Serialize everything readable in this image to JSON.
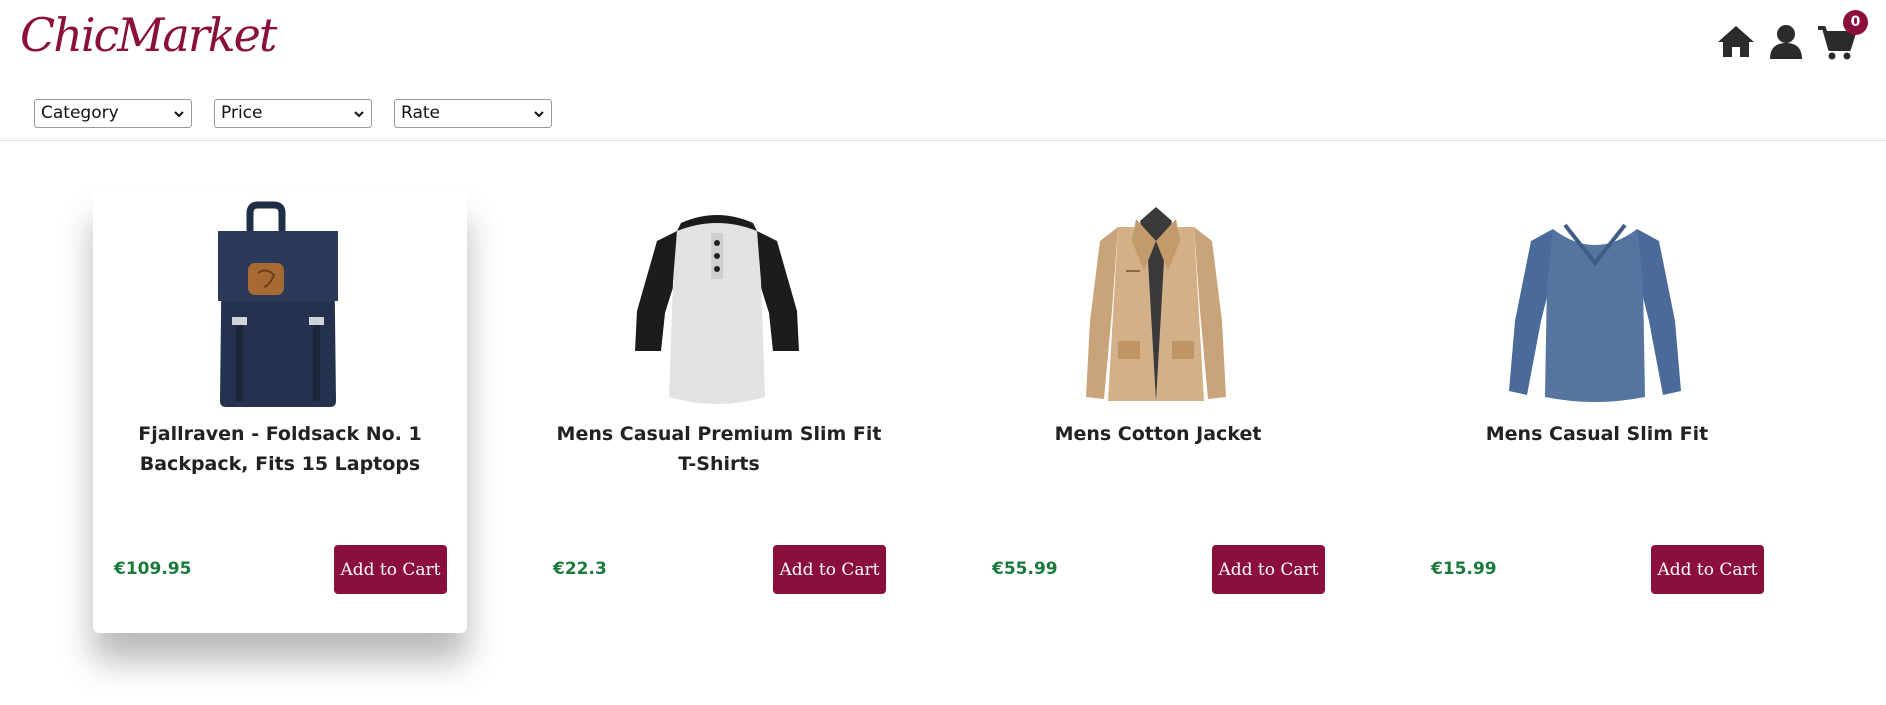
{
  "app": {
    "logo_text": "ChicMarket"
  },
  "nav": {
    "icons": [
      "home-icon",
      "user-icon",
      "cart-icon"
    ],
    "cart_count": "0"
  },
  "filters": [
    {
      "selected": "Category"
    },
    {
      "selected": "Price"
    },
    {
      "selected": "Rate"
    }
  ],
  "colors": {
    "brand": "#8a0f3c",
    "price": "#1a7a3c",
    "icons": "#2b2b2b"
  },
  "products": [
    {
      "title": "Fjallraven - Foldsack No. 1 Backpack, Fits 15 Laptops",
      "price": "€109.95",
      "button_label": "Add to Cart",
      "image": "backpack-image"
    },
    {
      "title": "Mens Casual Premium Slim Fit T-Shirts",
      "price": "€22.3",
      "button_label": "Add to Cart",
      "image": "raglan-tshirt-image"
    },
    {
      "title": "Mens Cotton Jacket",
      "price": "€55.99",
      "button_label": "Add to Cart",
      "image": "cotton-jacket-image"
    },
    {
      "title": "Mens Casual Slim Fit",
      "price": "€15.99",
      "button_label": "Add to Cart",
      "image": "slim-fit-shirt-image"
    }
  ]
}
